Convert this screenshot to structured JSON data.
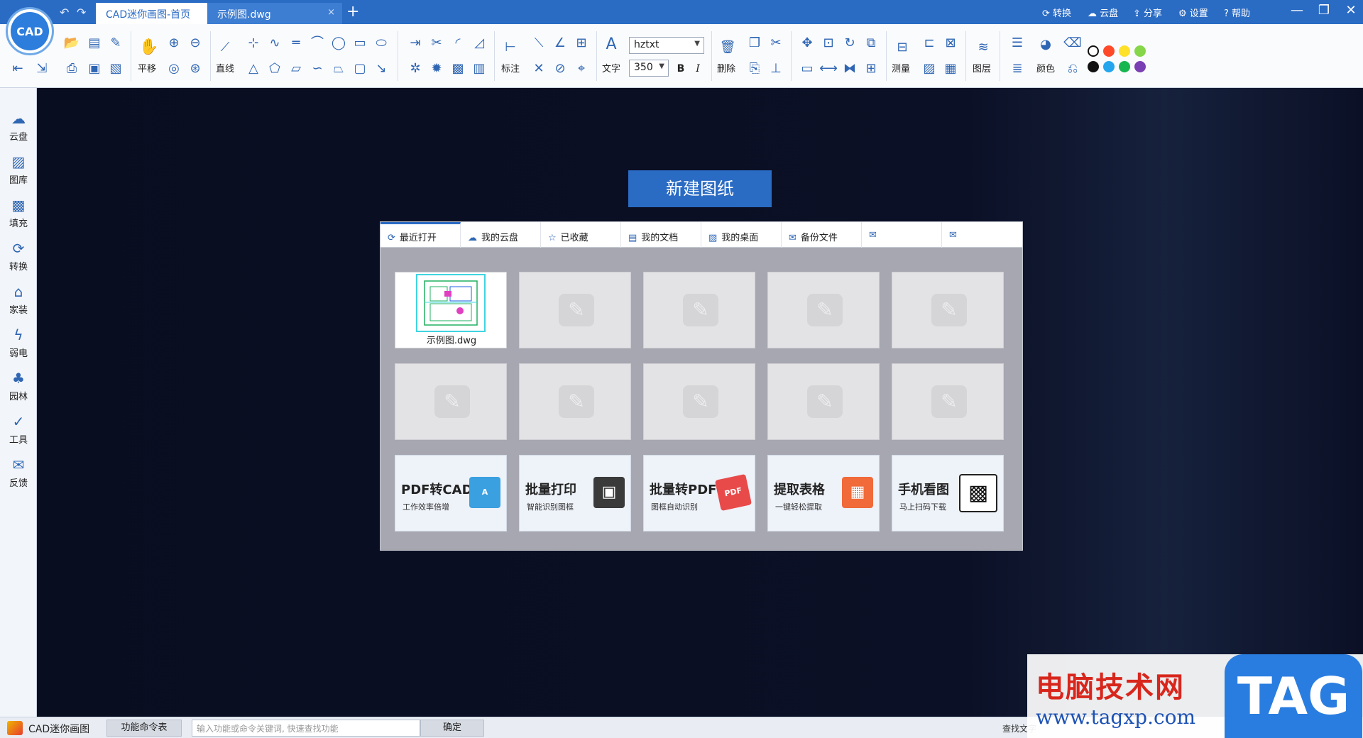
{
  "titlebar": {
    "logo_text": "CAD",
    "tabs": [
      {
        "label": "CAD迷你画图-首页"
      },
      {
        "label": "示例图.dwg"
      }
    ],
    "tab_close": "×",
    "add_tab": "+",
    "undo": "↶",
    "redo": "↷",
    "right_links": [
      "转换",
      "云盘",
      "分享",
      "设置",
      "帮助"
    ],
    "window_controls": [
      "—",
      "❐",
      "✕"
    ]
  },
  "toolbar": {
    "pan_label": "平移",
    "line_label": "直线",
    "dim_label": "标注",
    "text_label": "文字",
    "font_name": "hztxt",
    "font_size": "350",
    "bold": "B",
    "italic": "I",
    "delete_label": "删除",
    "measure_label": "测量",
    "layer_label": "图层",
    "color_label": "颜色",
    "color_swatches": [
      "#ffffff",
      "#ff4a2a",
      "#ffe12a",
      "#86d64a",
      "#111111",
      "#23a6ee",
      "#17b64e",
      "#7a3fb2"
    ]
  },
  "sidebar": {
    "items": [
      {
        "label": "云盘",
        "icon": "cloud-icon"
      },
      {
        "label": "图库",
        "icon": "gallery-icon"
      },
      {
        "label": "填充",
        "icon": "hatch-icon"
      },
      {
        "label": "转换",
        "icon": "convert-icon"
      },
      {
        "label": "家装",
        "icon": "home-icon"
      },
      {
        "label": "弱电",
        "icon": "lightning-icon"
      },
      {
        "label": "园林",
        "icon": "tree-icon"
      },
      {
        "label": "工具",
        "icon": "tool-icon"
      },
      {
        "label": "反馈",
        "icon": "mail-icon"
      }
    ]
  },
  "main": {
    "new_drawing": "新建图纸",
    "panel_tabs": [
      {
        "label": "最近打开",
        "icon": "refresh-icon"
      },
      {
        "label": "我的云盘",
        "icon": "cloud-icon"
      },
      {
        "label": "已收藏",
        "icon": "star-icon"
      },
      {
        "label": "我的文档",
        "icon": "document-icon"
      },
      {
        "label": "我的桌面",
        "icon": "image-icon"
      },
      {
        "label": "备份文件",
        "icon": "mail-icon"
      },
      {
        "label": "",
        "icon": "mail-icon"
      },
      {
        "label": "",
        "icon": "mail-icon"
      }
    ],
    "recent_file": "示例图.dwg",
    "promos": [
      {
        "title": "PDF转CAD",
        "subtitle": "工作效率倍增",
        "art": "A",
        "color": "#3aa0e0"
      },
      {
        "title": "批量打印",
        "subtitle": "智能识别图框",
        "art": "▣",
        "color": "#3a3a3a"
      },
      {
        "title": "批量转PDF",
        "subtitle": "图框自动识别",
        "art": "PDF",
        "color": "#e84a4a"
      },
      {
        "title": "提取表格",
        "subtitle": "一键轻松提取",
        "art": "▦",
        "color": "#f06a3a"
      },
      {
        "title": "手机看图",
        "subtitle": "马上扫码下载",
        "art": "▩",
        "color": "#222222"
      }
    ]
  },
  "statusbar": {
    "app_name": "CAD迷你画图",
    "cmd_table": "功能命令表",
    "cmd_placeholder": "输入功能或命令关键词, 快速查找功能",
    "confirm": "确定",
    "find_text": "查找文字"
  },
  "watermark": {
    "title": "电脑技术网",
    "url": "www.tagxp.com",
    "badge": "TAG"
  }
}
